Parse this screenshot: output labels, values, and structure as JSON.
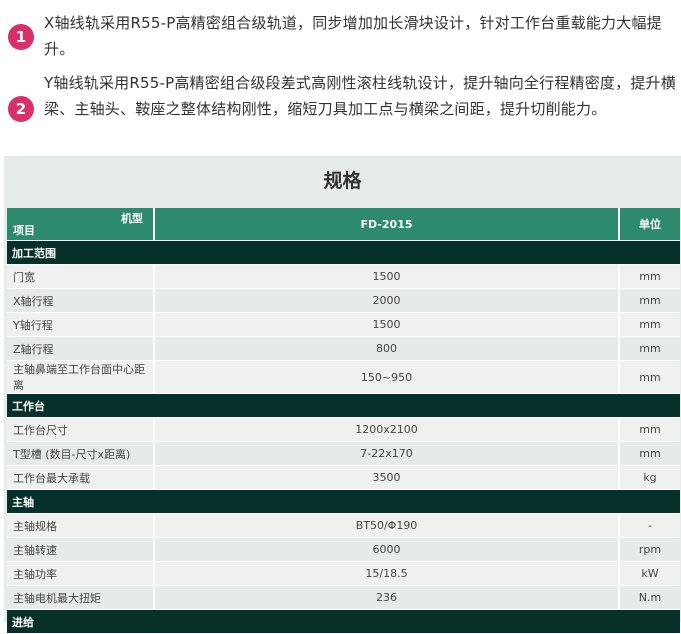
{
  "intro": [
    {
      "num": "1",
      "text": "X轴线轨采用R55-P高精密组合级轨道，同步增加加长滑块设计，针对工作台重载能力大幅提升。"
    },
    {
      "num": "2",
      "text": "Y轴线轨采用R55-P高精密组合级段差式高刚性滚柱线轨设计，提升轴向全行程精密度，提升横梁、主轴头、鞍座之整体结构刚性，缩短刀具加工点与横梁之间距，提升切削能力。"
    }
  ],
  "spec": {
    "title": "规格",
    "header": {
      "model_label": "机型",
      "item_label": "项目",
      "model_value": "FD-2015",
      "unit_label": "单位"
    },
    "sections": [
      {
        "name": "加工范围",
        "rows": [
          {
            "item": "门宽",
            "value": "1500",
            "unit": "mm"
          },
          {
            "item": "X轴行程",
            "value": "2000",
            "unit": "mm"
          },
          {
            "item": "Y轴行程",
            "value": "1500",
            "unit": "mm"
          },
          {
            "item": "Z轴行程",
            "value": "800",
            "unit": "mm"
          },
          {
            "item": "主轴鼻端至工作台面中心距离",
            "value": "150~950",
            "unit": "mm"
          }
        ]
      },
      {
        "name": "工作台",
        "rows": [
          {
            "item": "工作台尺寸",
            "value": "1200x2100",
            "unit": "mm"
          },
          {
            "item": "T型槽 (数目-尺寸x距离)",
            "value": "7-22x170",
            "unit": "mm"
          },
          {
            "item": "工作台最大承载",
            "value": "3500",
            "unit": "kg"
          }
        ]
      },
      {
        "name": "主轴",
        "rows": [
          {
            "item": "主轴规格",
            "value": "BT50/Φ190",
            "unit": "-"
          },
          {
            "item": "主轴转速",
            "value": "6000",
            "unit": "rpm"
          },
          {
            "item": "主轴功率",
            "value": "15/18.5",
            "unit": "kW"
          },
          {
            "item": "主轴电机最大扭矩",
            "value": "236",
            "unit": "N.m"
          }
        ]
      },
      {
        "name": "进给",
        "rows": []
      }
    ]
  }
}
